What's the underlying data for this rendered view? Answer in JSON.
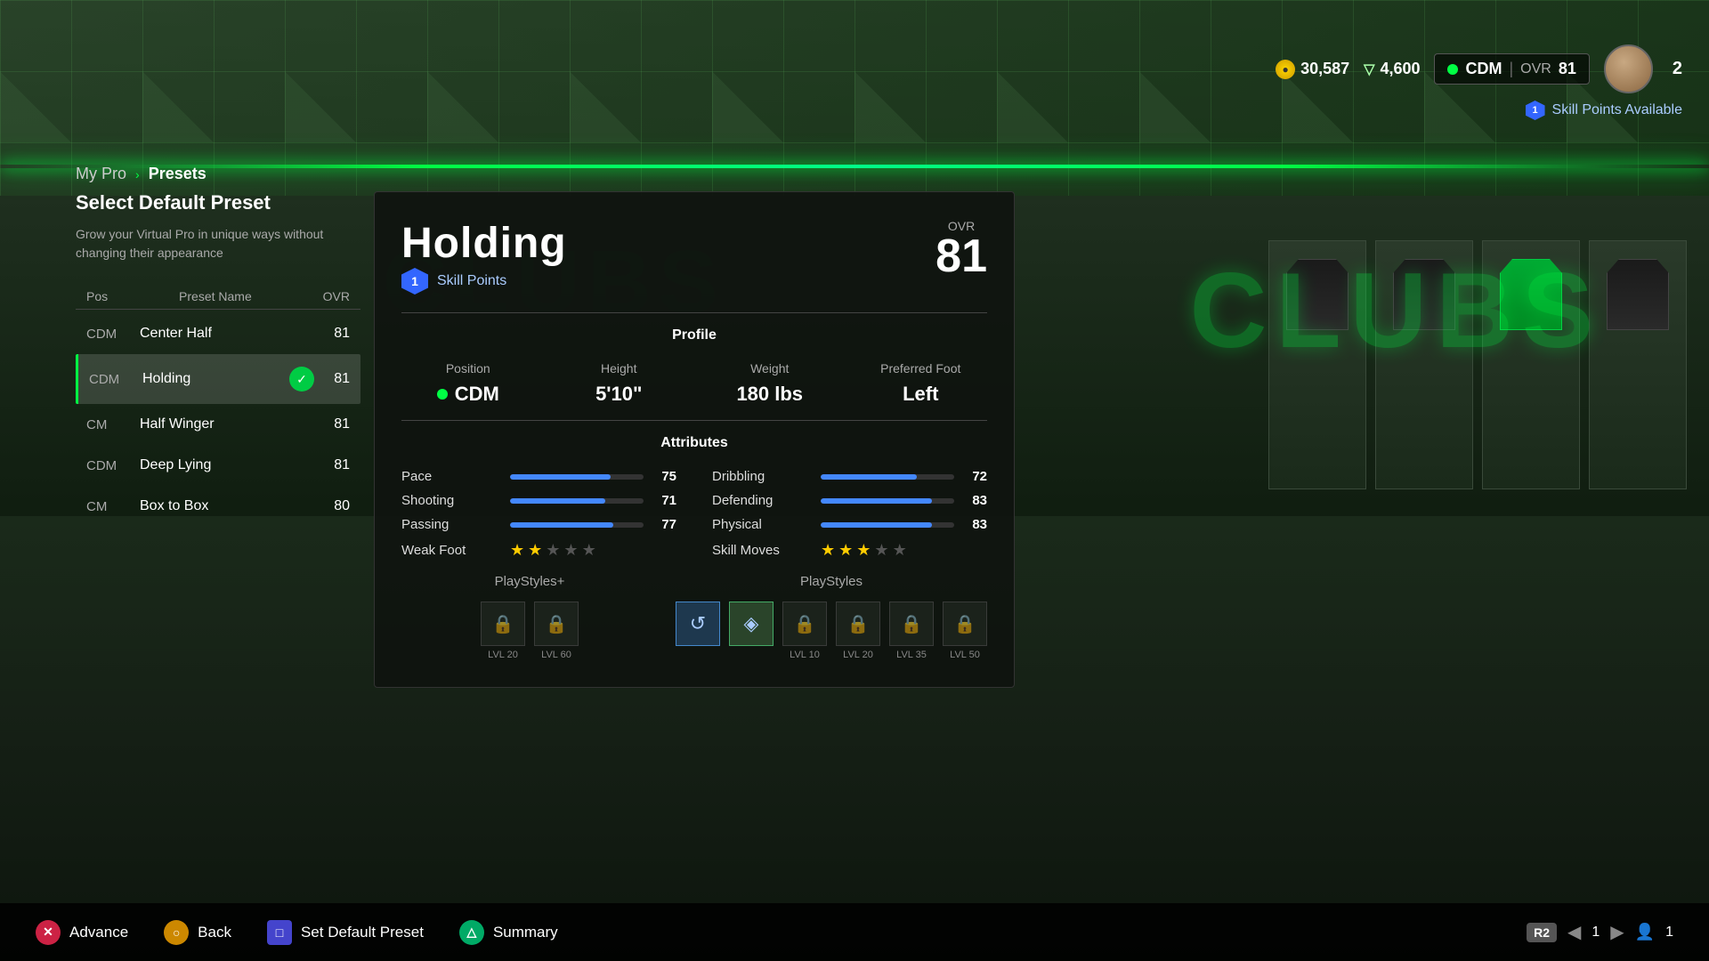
{
  "background": {
    "clubs_text": "CLUBS"
  },
  "hud": {
    "coins": "30,587",
    "tokens": "4,600",
    "position": "CDM",
    "ovr_label": "OVR",
    "ovr_value": "81",
    "player_number": "2",
    "skill_points_available": "1",
    "skill_points_text": "Skill Points Available"
  },
  "breadcrumb": {
    "my_pro": "My Pro",
    "chevron": "›",
    "presets": "Presets"
  },
  "left_panel": {
    "title": "Select Default Preset",
    "description": "Grow your Virtual Pro in unique ways without changing their appearance",
    "columns": {
      "pos": "Pos",
      "preset_name": "Preset Name",
      "ovr": "OVR"
    },
    "presets": [
      {
        "pos": "CDM",
        "name": "Center Half",
        "ovr": "81",
        "selected": false,
        "checked": false
      },
      {
        "pos": "CDM",
        "name": "Holding",
        "ovr": "81",
        "selected": true,
        "checked": true
      },
      {
        "pos": "CM",
        "name": "Half Winger",
        "ovr": "81",
        "selected": false,
        "checked": false
      },
      {
        "pos": "CDM",
        "name": "Deep Lying",
        "ovr": "81",
        "selected": false,
        "checked": false
      },
      {
        "pos": "CM",
        "name": "Box to Box",
        "ovr": "80",
        "selected": false,
        "checked": false
      }
    ]
  },
  "main_card": {
    "title": "Holding",
    "ovr_label": "OVR",
    "ovr_value": "81",
    "skill_points_count": "1",
    "skill_points_label": "Skill Points",
    "profile_section": "Profile",
    "position_label": "Position",
    "position_value": "CDM",
    "height_label": "Height",
    "height_value": "5'10\"",
    "weight_label": "Weight",
    "weight_value": "180 lbs",
    "preferred_foot_label": "Preferred Foot",
    "preferred_foot_value": "Left",
    "attributes_section": "Attributes",
    "attributes": [
      {
        "name": "Pace",
        "value": 75,
        "side": "left"
      },
      {
        "name": "Shooting",
        "value": 71,
        "side": "left"
      },
      {
        "name": "Passing",
        "value": 77,
        "side": "left"
      },
      {
        "name": "Weak Foot",
        "stars": 2,
        "max_stars": 5,
        "side": "left"
      },
      {
        "name": "Dribbling",
        "value": 72,
        "side": "right"
      },
      {
        "name": "Defending",
        "value": 83,
        "side": "right"
      },
      {
        "name": "Physical",
        "value": 83,
        "side": "right"
      },
      {
        "name": "Skill Moves",
        "stars": 3,
        "max_stars": 5,
        "side": "right"
      }
    ],
    "playstyles_plus_label": "PlayStyles+",
    "playstyles_plus": [
      {
        "locked": true,
        "lvl": "LVL 20"
      },
      {
        "locked": true,
        "lvl": "LVL 60"
      }
    ],
    "playstyles_label": "PlayStyles",
    "playstyles": [
      {
        "locked": false,
        "active": true,
        "symbol": "↺"
      },
      {
        "locked": false,
        "active": true,
        "symbol": "◈"
      },
      {
        "locked": true,
        "lvl": "LVL 10"
      },
      {
        "locked": true,
        "lvl": "LVL 20"
      },
      {
        "locked": true,
        "lvl": "LVL 35"
      },
      {
        "locked": true,
        "lvl": "LVL 50"
      }
    ]
  },
  "bottom_bar": {
    "advance_label": "Advance",
    "back_label": "Back",
    "set_default_label": "Set Default Preset",
    "summary_label": "Summary",
    "r2_badge": "R2",
    "page_current": "1",
    "page_total": "1"
  }
}
